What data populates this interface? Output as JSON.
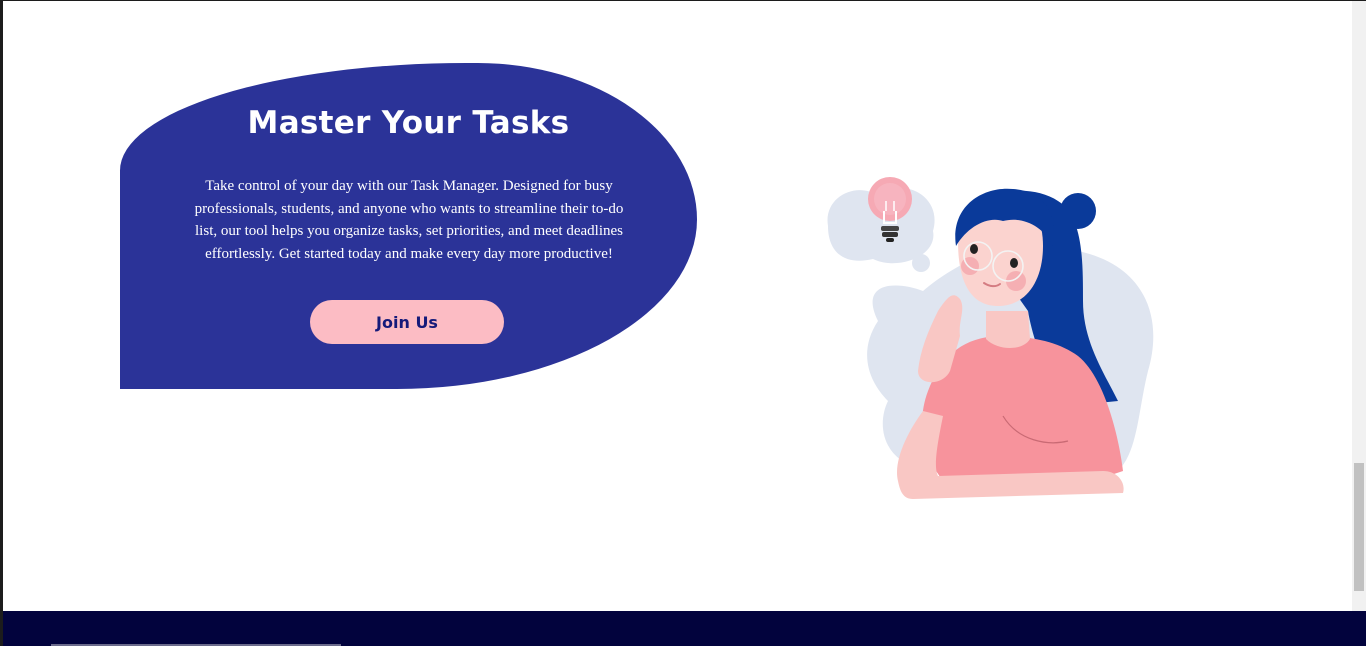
{
  "hero": {
    "title": "Master Your Tasks",
    "description": "Take control of your day with our Task Manager. Designed for busy professionals, students, and anyone who wants to streamline their to-do list, our tool helps you organize tasks, set priorities, and meet deadlines effortlessly. Get started today and make every day more productive!",
    "cta_label": "Join Us"
  },
  "illustration": {
    "icon": "thinking-woman-illustration",
    "bulb_icon": "lightbulb-icon"
  },
  "colors": {
    "hero_background": "#2b3398",
    "button_background": "#fcbcc4",
    "button_text": "#151a7a",
    "footer_background": "#02033d",
    "hair": "#0a3a9a",
    "shirt": "#f7939c",
    "skin": "#f9c7c4",
    "blob": "#dfe5f0"
  }
}
